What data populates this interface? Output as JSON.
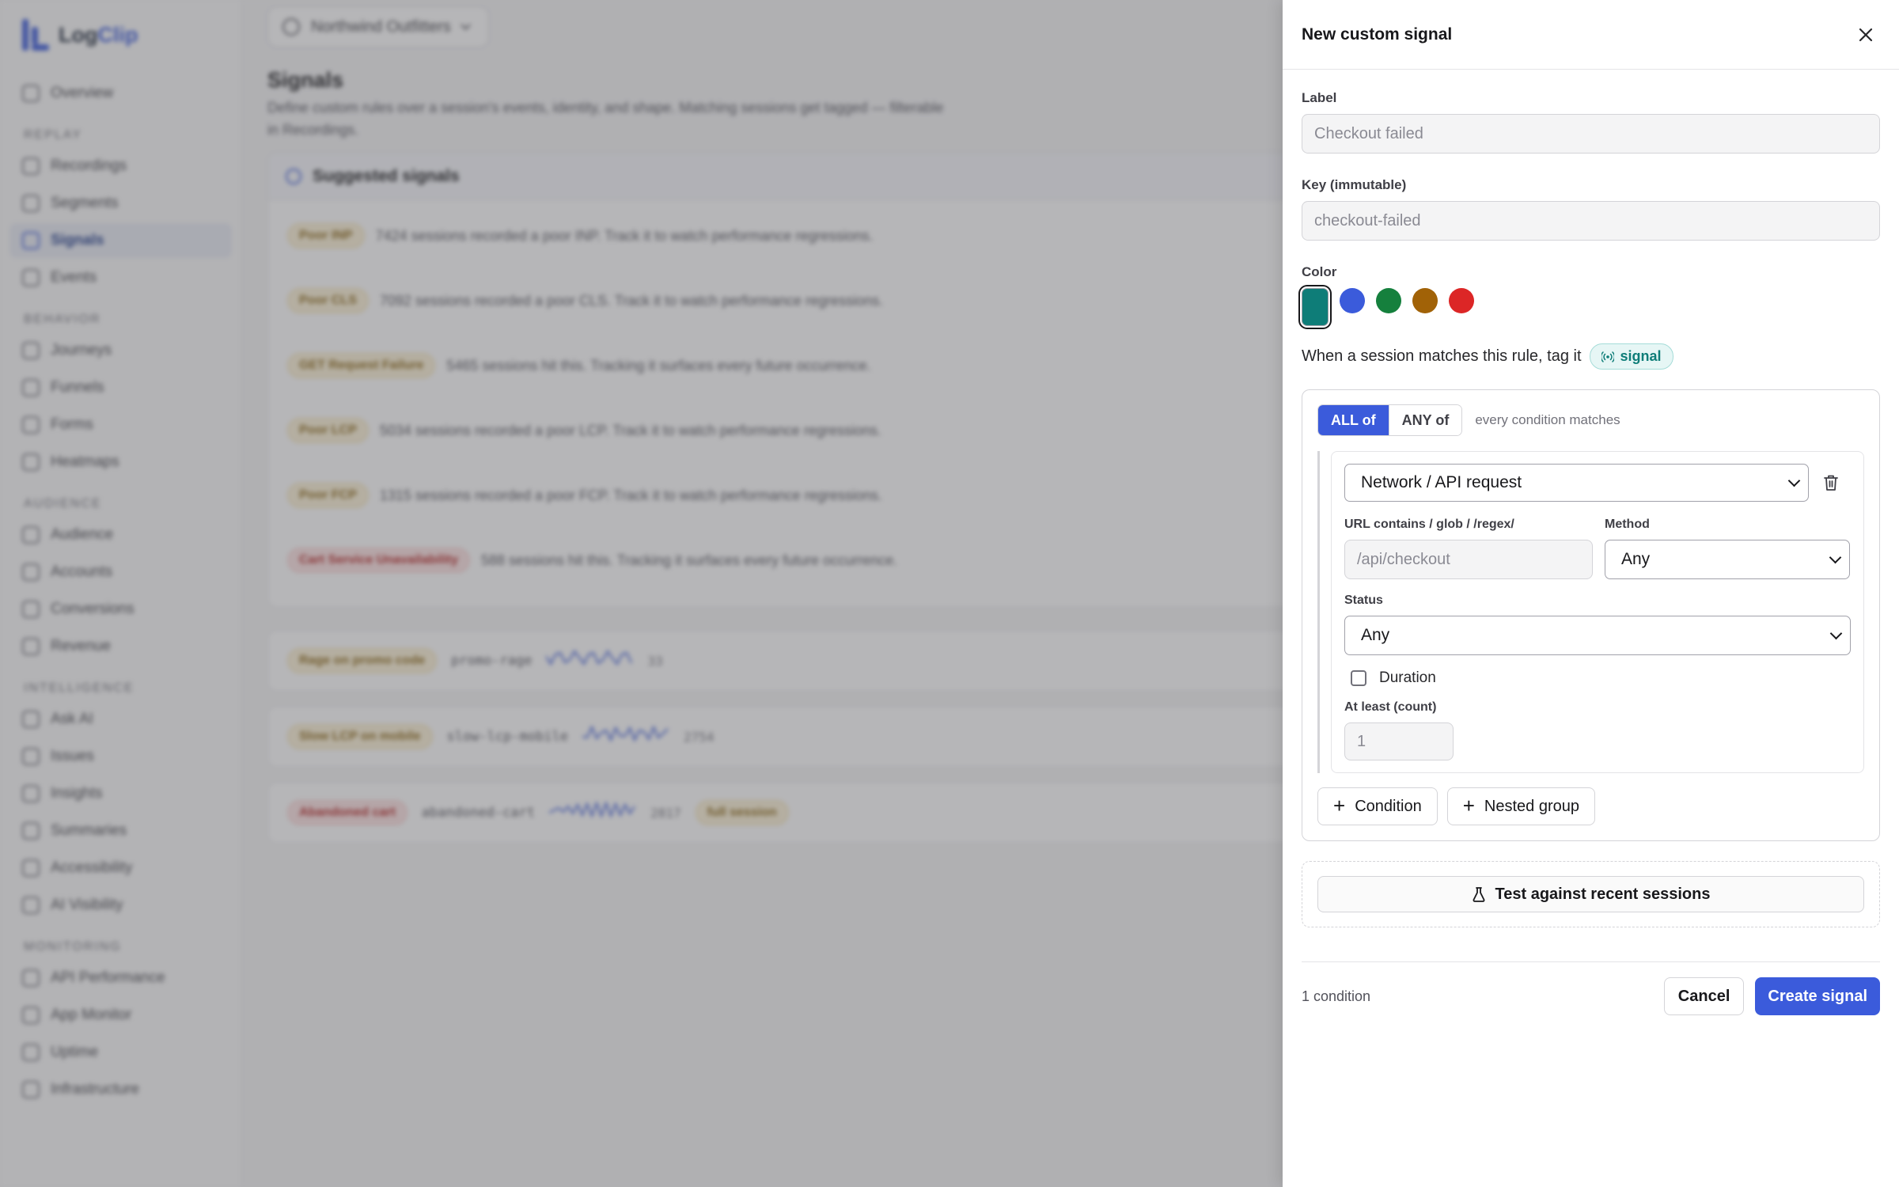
{
  "brand": {
    "name_a": "Log",
    "name_b": "Clip"
  },
  "sidebar": {
    "top": [
      {
        "label": "Overview",
        "icon": "grid-icon"
      }
    ],
    "sections": [
      {
        "title": "REPLAY",
        "items": [
          {
            "label": "Recordings",
            "icon": "play-icon",
            "active": false
          },
          {
            "label": "Segments",
            "icon": "layers-icon",
            "active": false
          },
          {
            "label": "Signals",
            "icon": "signal-icon",
            "active": true
          },
          {
            "label": "Events",
            "icon": "events-icon",
            "active": false
          }
        ]
      },
      {
        "title": "BEHAVIOR",
        "items": [
          {
            "label": "Journeys",
            "icon": "route-icon",
            "active": false
          },
          {
            "label": "Funnels",
            "icon": "funnel-icon",
            "active": false
          },
          {
            "label": "Forms",
            "icon": "form-icon",
            "active": false
          },
          {
            "label": "Heatmaps",
            "icon": "flame-icon",
            "active": false
          }
        ]
      },
      {
        "title": "AUDIENCE",
        "items": [
          {
            "label": "Audience",
            "icon": "users-icon",
            "active": false
          },
          {
            "label": "Accounts",
            "icon": "account-icon",
            "active": false
          },
          {
            "label": "Conversions",
            "icon": "target-icon",
            "active": false
          },
          {
            "label": "Revenue",
            "icon": "dollar-icon",
            "active": false
          }
        ]
      },
      {
        "title": "INTELLIGENCE",
        "items": [
          {
            "label": "Ask AI",
            "icon": "sparkle-icon",
            "active": false
          },
          {
            "label": "Issues",
            "icon": "bug-icon",
            "active": false
          },
          {
            "label": "Insights",
            "icon": "bulb-icon",
            "active": false
          },
          {
            "label": "Summaries",
            "icon": "summary-icon",
            "active": false
          },
          {
            "label": "Accessibility",
            "icon": "accessibility-icon",
            "active": false
          },
          {
            "label": "AI Visibility",
            "icon": "eye-icon",
            "active": false
          }
        ]
      },
      {
        "title": "MONITORING",
        "items": [
          {
            "label": "API Performance",
            "icon": "api-icon",
            "active": false
          },
          {
            "label": "App Monitor",
            "icon": "monitor-icon",
            "active": false
          },
          {
            "label": "Uptime",
            "icon": "uptime-icon",
            "active": false
          },
          {
            "label": "Infrastructure",
            "icon": "server-icon",
            "active": false
          }
        ]
      }
    ]
  },
  "header": {
    "workspace": "Northwind Outfitters"
  },
  "page": {
    "title": "Signals",
    "description": "Define custom rules over a session's events, identity, and shape. Matching sessions get tagged — filterable in Recordings."
  },
  "suggested": {
    "title": "Suggested signals",
    "rows": [
      {
        "pill": "Poor INP",
        "tone": "amber",
        "text": "7424 sessions recorded a poor INP. Track it to watch performance regressions."
      },
      {
        "pill": "Poor CLS",
        "tone": "amber",
        "text": "7092 sessions recorded a poor CLS. Track it to watch performance regressions."
      },
      {
        "pill": "GET Request Failure",
        "tone": "amber",
        "text": "5465 sessions hit this. Tracking it surfaces every future occurrence."
      },
      {
        "pill": "Poor LCP",
        "tone": "amber",
        "text": "5034 sessions recorded a poor LCP. Track it to watch performance regressions."
      },
      {
        "pill": "Poor FCP",
        "tone": "amber",
        "text": "1315 sessions recorded a poor FCP. Track it to watch performance regressions."
      },
      {
        "pill": "Cart Service Unavailability",
        "tone": "red",
        "text": "588 sessions hit this. Tracking it surfaces every future occurrence."
      }
    ]
  },
  "signals": [
    {
      "label": "Rage on promo code",
      "tone": "amber",
      "key": "promo-rage",
      "count": "33",
      "badge": ""
    },
    {
      "label": "Slow LCP on mobile",
      "tone": "amber",
      "key": "slow-lcp-mobile",
      "count": "2754",
      "badge": ""
    },
    {
      "label": "Abandoned cart",
      "tone": "red",
      "key": "abandoned-cart",
      "count": "2817",
      "badge": "full session"
    }
  ],
  "drawer": {
    "title": "New custom signal",
    "label_field": {
      "label": "Label",
      "placeholder": "Checkout failed"
    },
    "key_field": {
      "label": "Key (immutable)",
      "placeholder": "checkout-failed"
    },
    "color": {
      "label": "Color",
      "swatches": [
        "#0e7d78",
        "#3b5bdb",
        "#15803d",
        "#a16207",
        "#dc2626"
      ],
      "selected_index": 0
    },
    "tag_line": "When a session matches this rule, tag it",
    "tag_chip": "signal",
    "rule": {
      "mode_all": "ALL of",
      "mode_any": "ANY of",
      "active_mode": "all",
      "hint": "every condition matches",
      "condition": {
        "type": "Network / API request",
        "url_label": "URL contains / glob / /regex/",
        "url_placeholder": "/api/checkout",
        "method_label": "Method",
        "method_value": "Any",
        "status_label": "Status",
        "status_value": "Any",
        "duration_label": "Duration",
        "duration_checked": false,
        "count_label": "At least (count)",
        "count_placeholder": "1"
      },
      "add_condition": "Condition",
      "add_group": "Nested group"
    },
    "test_button": "Test against recent sessions",
    "footer": {
      "count_text": "1 condition",
      "cancel": "Cancel",
      "create": "Create signal"
    }
  }
}
